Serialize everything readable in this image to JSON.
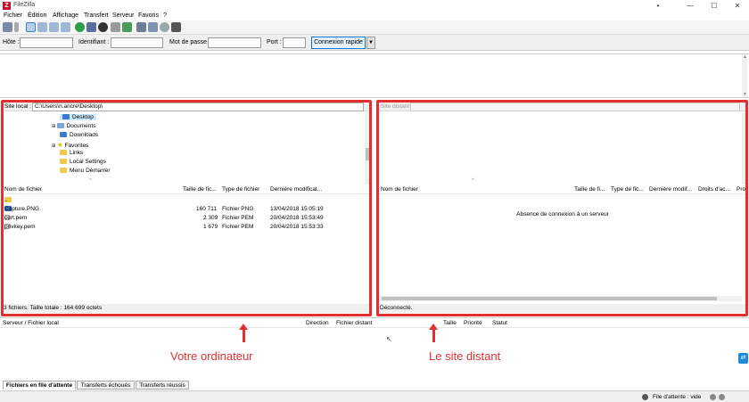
{
  "window": {
    "title": "FileZilla",
    "app_icon": "Z"
  },
  "menu": [
    "Fichier",
    "Édition",
    "Affichage",
    "Transfert",
    "Serveur",
    "Favoris",
    "?"
  ],
  "quickconnect": {
    "host_label": "Hôte :",
    "user_label": "Identifiant :",
    "pass_label": "Mot de passe :",
    "port_label": "Port :",
    "connect_button": "Connexion rapide",
    "host_value": "",
    "user_value": "",
    "pass_value": "",
    "port_value": ""
  },
  "local": {
    "site_label": "Site local :",
    "path": "C:\\Users\\n.ancre\\Desktop\\",
    "tree": [
      "Desktop",
      "Documents",
      "Downloads",
      "Favorites",
      "Links",
      "Local Settings",
      "Menu Démarrer"
    ],
    "headers": [
      "Nom de fichier",
      "Taille de fic...",
      "Type de fichier",
      "Dernière modificat..."
    ],
    "files": [
      {
        "name": "..",
        "size": "",
        "type": "",
        "date": ""
      },
      {
        "name": "Capture.PNG",
        "size": "160 711",
        "type": "Fichier PNG",
        "date": "13/04/2018 15:05:19"
      },
      {
        "name": "cert.pem",
        "size": "2 309",
        "type": "Fichier PEM",
        "date": "20/04/2018 15:53:49"
      },
      {
        "name": "privkey.pem",
        "size": "1 679",
        "type": "Fichier PEM",
        "date": "20/04/2018 15:53:33"
      }
    ],
    "status": "3 fichiers. Taille totale : 164 699 octets"
  },
  "remote": {
    "site_label": "Site distant :",
    "path": "",
    "headers": [
      "Nom de fichier",
      "Taille de fi...",
      "Type de fic...",
      "Dernière modif...",
      "Droits d'ac...",
      "Pro"
    ],
    "empty_message": "Absence de connexion à un serveur",
    "status": "Déconnecté."
  },
  "queue": {
    "headers": [
      "Serveur / Fichier local",
      "Direction",
      "Fichier distant",
      "Taille",
      "Priorité",
      "Statut"
    ]
  },
  "tabs": [
    "Fichiers en file d'attente",
    "Transferts échoués",
    "Transferts réussis"
  ],
  "statusbar": {
    "queue": "File d'attente : vide"
  },
  "annotations": {
    "local": "Votre ordinateur",
    "remote": "Le site distant"
  },
  "colors": {
    "annotation": "#e03030",
    "accent": "#0078d7"
  }
}
